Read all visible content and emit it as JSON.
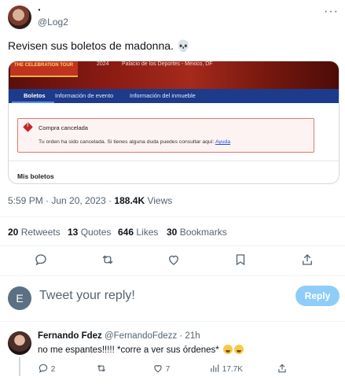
{
  "header": {
    "display_name": "·",
    "handle": "@Log2",
    "more_label": "···"
  },
  "tweet": {
    "text": "Revisen sus boletos de madonna. 💀"
  },
  "card": {
    "poster_text": "THE CELEBRATION TOUR",
    "year": "2024",
    "venue": "Palacio de los Deportes - Mexico, DF",
    "tabs": [
      {
        "label": "Boletos"
      },
      {
        "label": "Información de evento"
      },
      {
        "label": "Información del inmueble"
      }
    ],
    "alert": {
      "icon_mark": "!",
      "title": "Compra cancelada",
      "body": "Tu orden ha sido cancelada. Si tienes alguna duda puedes consultar aquí:",
      "link": "Ayuda"
    },
    "section_title": "Mis boletos"
  },
  "meta": {
    "time_date": "5:59 PM · Jun 20, 2023 · ",
    "views_count": "188.4K",
    "views_label": " Views"
  },
  "stats": {
    "retweets_count": "20",
    "retweets_label": " Retweets",
    "quotes_count": "13",
    "quotes_label": " Quotes",
    "likes_count": "646",
    "likes_label": " Likes",
    "bookmarks_count": "30",
    "bookmarks_label": " Bookmarks"
  },
  "reply_box": {
    "avatar_letter": "E",
    "placeholder": "Tweet your reply!",
    "button_label": "Reply",
    "button_color": "#8ecdf8"
  },
  "reply": {
    "name": "Fernando Fdez",
    "handle_time": "@FernandoFdezz · 21h",
    "text": "no me espantes!!!!! *corre a ver sus órdenes*",
    "replies": "2",
    "retweets": "",
    "likes": "7",
    "views": "17.7K"
  },
  "colors": {
    "accent": "#1d9bf0",
    "nav_blue": "#1e3a8a",
    "alert_red": "#c62828"
  }
}
